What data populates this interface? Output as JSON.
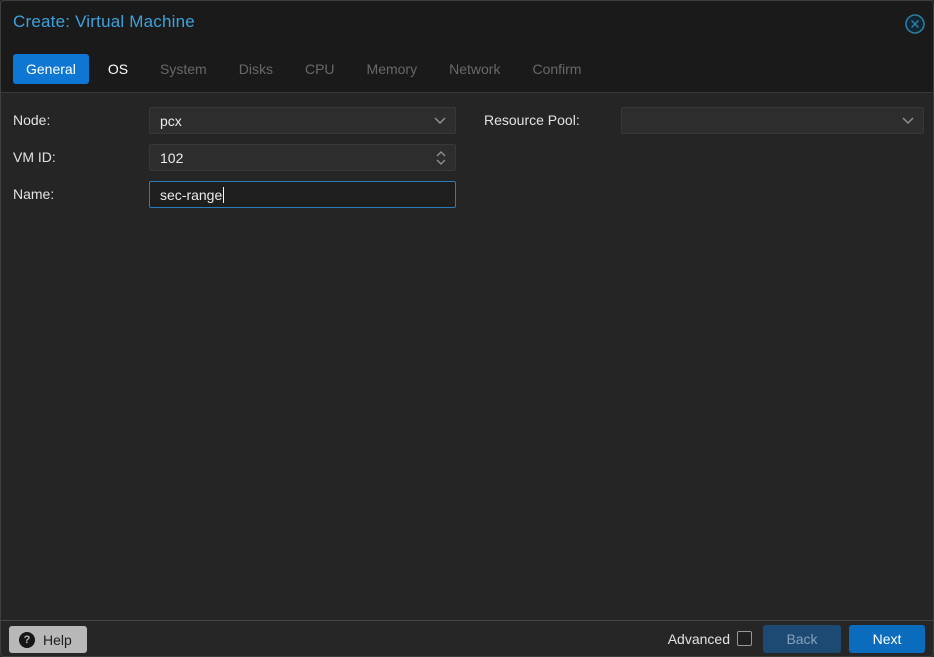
{
  "window": {
    "title": "Create: Virtual Machine"
  },
  "icons": {
    "close": "circle-x",
    "help_glyph": "?",
    "node_field": "chevron-down",
    "vmid_field": "spinner-up-down",
    "resource_pool_field": "chevron-down"
  },
  "tabs": [
    {
      "label": "General",
      "state": "active"
    },
    {
      "label": "OS",
      "state": "enabled"
    },
    {
      "label": "System",
      "state": "disabled"
    },
    {
      "label": "Disks",
      "state": "disabled"
    },
    {
      "label": "CPU",
      "state": "disabled"
    },
    {
      "label": "Memory",
      "state": "disabled"
    },
    {
      "label": "Network",
      "state": "disabled"
    },
    {
      "label": "Confirm",
      "state": "disabled"
    }
  ],
  "form": {
    "node": {
      "label": "Node:",
      "value": "pcx"
    },
    "vmid": {
      "label": "VM ID:",
      "value": "102"
    },
    "name": {
      "label": "Name:",
      "value": "sec-range",
      "focused": true
    },
    "resource_pool": {
      "label": "Resource Pool:",
      "value": ""
    }
  },
  "footer": {
    "help_label": "Help",
    "advanced_label": "Advanced",
    "advanced_checked": false,
    "back_label": "Back",
    "next_label": "Next"
  },
  "colors": {
    "accent_blue": "#0e77d4",
    "title_blue": "#3da2dc",
    "window_bg": "#252525",
    "header_bg": "#1a1a1a",
    "field_bg": "#2d2d2d",
    "focused_field_border": "#2b7cb9",
    "disabled_text": "#686868",
    "next_button_bg": "#0b6cbd",
    "back_button_bg": "#1c4a72",
    "back_button_text": "#87a2ba",
    "help_button_bg": "#b8b8b8",
    "close_icon": "#2a7ca3"
  }
}
